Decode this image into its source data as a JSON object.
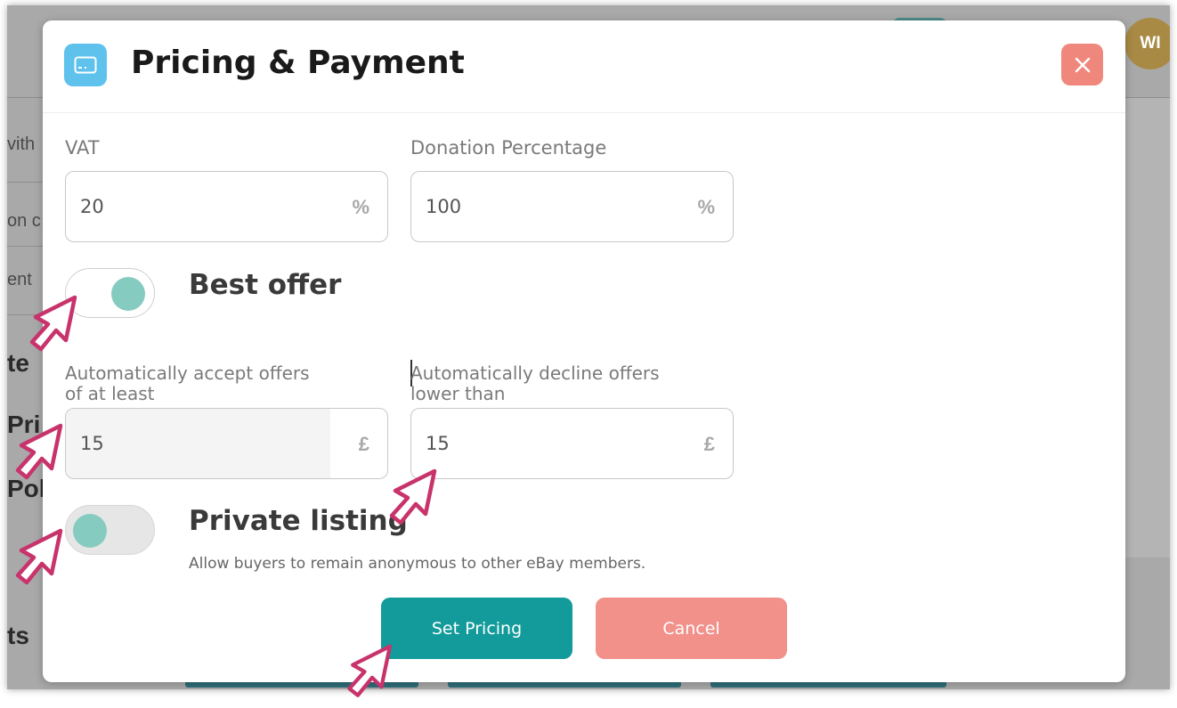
{
  "background": {
    "avatar_initials": "WI",
    "left_fragments": [
      "vith",
      "on c",
      "ent"
    ],
    "left_headings": [
      "te",
      "Pri",
      "Pol",
      "ts"
    ]
  },
  "modal": {
    "title": "Pricing & Payment",
    "icon": "credit-card-icon",
    "close_icon": "close-icon",
    "vat": {
      "label": "VAT",
      "value": "20",
      "unit": "%"
    },
    "donation": {
      "label": "Donation Percentage",
      "value": "100",
      "unit": "%"
    },
    "best_offer": {
      "label": "Best offer",
      "enabled": true
    },
    "accept_offers": {
      "label_line1": "Automatically accept offers",
      "label_line2": "of at least",
      "value": "15",
      "unit": "£"
    },
    "decline_offers": {
      "label_line1": "Automatically decline offers",
      "label_line2": "lower than",
      "value": "15",
      "unit": "£"
    },
    "private_listing": {
      "label": "Private listing",
      "enabled": false,
      "helper": "Allow buyers to remain anonymous to other eBay members."
    },
    "buttons": {
      "primary": "Set Pricing",
      "cancel": "Cancel"
    }
  },
  "colors": {
    "accent_teal": "#139b9b",
    "cancel_salmon": "#f2908a",
    "close_salmon": "#f0877c",
    "icon_blue": "#5ec2ec",
    "toggle_knob": "#86cbbf",
    "pointer_stroke": "#c8336b"
  }
}
